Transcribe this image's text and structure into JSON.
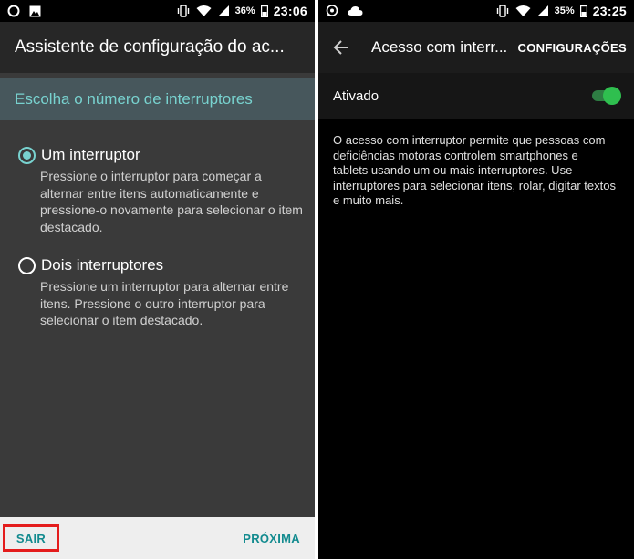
{
  "left": {
    "status_bar": {
      "battery": "36%",
      "time": "23:06"
    },
    "title": "Assistente de configuração do ac...",
    "section_header": "Escolha o número de interruptores",
    "options": [
      {
        "label": "Um interruptor",
        "description": "Pressione o interruptor para começar a alternar entre itens automaticamente e pressione-o novamente para selecionar o item destacado.",
        "selected": true
      },
      {
        "label": "Dois interruptores",
        "description": "Pressione um interruptor para alternar entre itens. Pressione o outro interruptor para selecionar o item destacado.",
        "selected": false
      }
    ],
    "footer": {
      "exit_label": "SAIR",
      "next_label": "PRÓXIMA"
    },
    "colors": {
      "accent": "#78d2cf",
      "highlight_box": "#e41c1c",
      "footer_text": "#138b8f"
    }
  },
  "right": {
    "status_bar": {
      "battery": "35%",
      "time": "23:25"
    },
    "title": "Acesso com interr...",
    "action_label": "CONFIGURAÇÕES",
    "toggle": {
      "label": "Ativado",
      "on": true
    },
    "description": "O acesso com interruptor permite que pessoas com deficiências motoras controlem smartphones e tablets usando um ou mais interruptores. Use interruptores para selecionar itens, rolar, digitar textos e muito mais.",
    "colors": {
      "switch_on": "#2fbf4f"
    }
  },
  "icons": {
    "left_status": [
      "circle-icon",
      "image-icon",
      "vibrate-icon",
      "wifi-icon",
      "signal-icon",
      "battery-icon"
    ],
    "right_status": [
      "whatsapp-icon",
      "cloud-icon",
      "vibrate-icon",
      "wifi-icon",
      "signal-icon",
      "battery-icon"
    ],
    "appbar": [
      "back-arrow-icon"
    ]
  }
}
